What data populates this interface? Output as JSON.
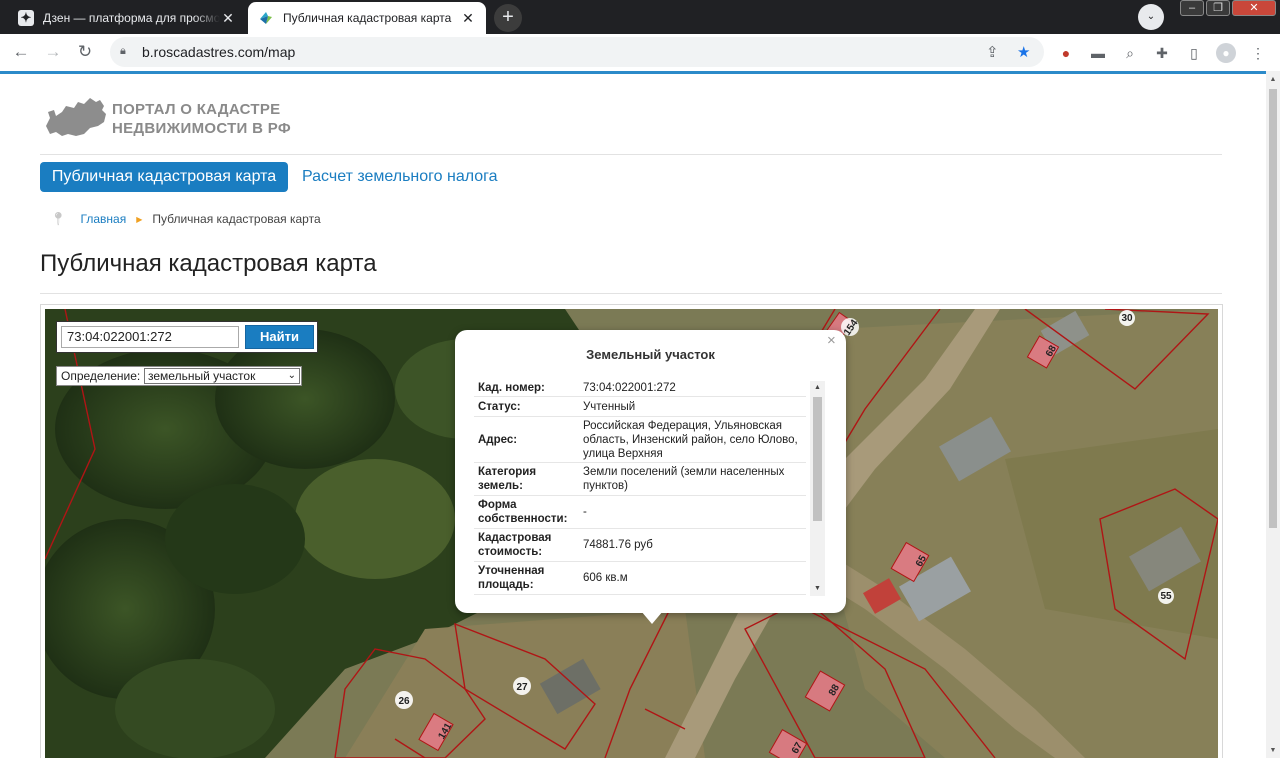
{
  "browser": {
    "tabs": [
      {
        "title": "Дзен — платформа для просмотра",
        "favicon": "zen-icon",
        "active": false
      },
      {
        "title": "Публичная кадастровая карта",
        "favicon": "rosreestr-icon",
        "active": true
      }
    ],
    "new_tab": "+",
    "url": "b.roscadastres.com/map"
  },
  "site": {
    "logo_line1": "ПОРТАЛ О КАДАСТРЕ",
    "logo_line2": "НЕДВИЖИМОСТИ В РФ",
    "nav": {
      "active": "Публичная кадастровая карта",
      "link": "Расчет земельного налога"
    },
    "breadcrumb": {
      "home": "Главная",
      "current": "Публичная кадастровая карта"
    },
    "page_title": "Публичная кадастровая карта"
  },
  "map": {
    "search": {
      "value": "73:04:022001:272",
      "button": "Найти"
    },
    "definition": {
      "label": "Определение:",
      "selected": "земельный участок"
    },
    "parcel_labels": [
      "154",
      "30",
      "68",
      "65",
      "55",
      "88",
      "67",
      "27",
      "26",
      "141"
    ],
    "popup": {
      "title": "Земельный участок",
      "close": "×",
      "rows": [
        {
          "key": "Кад. номер:",
          "value": "73:04:022001:272"
        },
        {
          "key": "Статус:",
          "value": "Учтенный"
        },
        {
          "key": "Адрес:",
          "value": "Российская Федерация, Ульяновская область, Инзенский район, село Юлово, улица Верхняя"
        },
        {
          "key": "Категория земель:",
          "value": "Земли поселений (земли населенных пунктов)"
        },
        {
          "key": "Форма собственности:",
          "value": "-"
        },
        {
          "key": "Кадастровая стоимость:",
          "value": "74881.76 руб"
        },
        {
          "key": "Уточненная площадь:",
          "value": "606 кв.м"
        }
      ]
    }
  },
  "colors": {
    "accent": "#1a7dc1",
    "parcel_line": "#b01515",
    "parcel_fill": "#e87a88"
  }
}
